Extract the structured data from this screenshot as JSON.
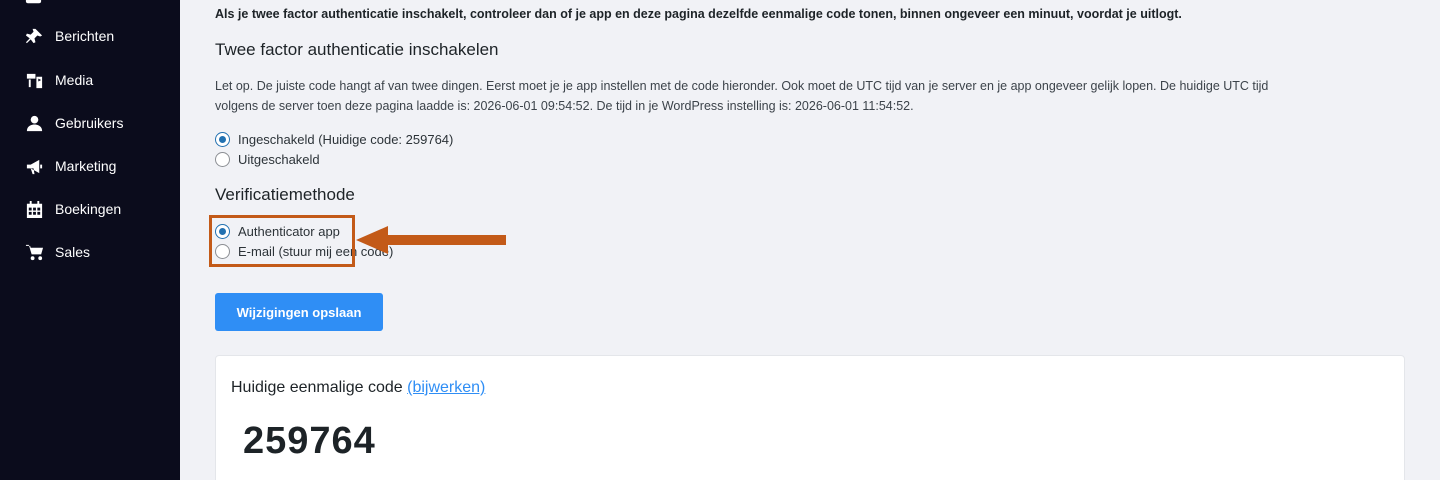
{
  "sidebar": {
    "items": [
      {
        "label": "Berichten",
        "icon": "pin-icon"
      },
      {
        "label": "Media",
        "icon": "media-icon"
      },
      {
        "label": "Gebruikers",
        "icon": "user-icon"
      },
      {
        "label": "Marketing",
        "icon": "megaphone-icon"
      },
      {
        "label": "Boekingen",
        "icon": "calendar-icon"
      },
      {
        "label": "Sales",
        "icon": "cart-icon"
      }
    ]
  },
  "main": {
    "intro": "Als je twee factor authenticatie inschakelt, controleer dan of je app en deze pagina dezelfde eenmalige code tonen, binnen ongeveer een minuut, voordat je uitlogt.",
    "title": "Twee factor authenticatie inschakelen",
    "note_line1": "Let op. De juiste code hangt af van twee dingen. Eerst moet je je app instellen met de code hieronder. Ook moet de UTC tijd van je server en je app ongeveer gelijk lopen. De huidige UTC tijd",
    "note_line2": "volgens de server toen deze pagina laadde is: 2026-06-01 09:54:52. De tijd in je WordPress instelling is: 2026-06-01 11:54:52.",
    "status_options": [
      {
        "label": "Ingeschakeld (Huidige code: 259764)",
        "checked": true
      },
      {
        "label": "Uitgeschakeld",
        "checked": false
      }
    ],
    "verification_title": "Verificatiemethode",
    "verification_options": [
      {
        "label": "Authenticator app",
        "checked": true
      },
      {
        "label": "E-mail (stuur mij een code)",
        "checked": false
      }
    ],
    "save_label": "Wijzigingen opslaan",
    "card": {
      "title": "Huidige eenmalige code",
      "refresh_link": "(bijwerken)",
      "code": "259764"
    }
  },
  "colors": {
    "sidebar_bg": "#0b0c1c",
    "accent": "#2f8ef5",
    "highlight": "#c35a18"
  }
}
